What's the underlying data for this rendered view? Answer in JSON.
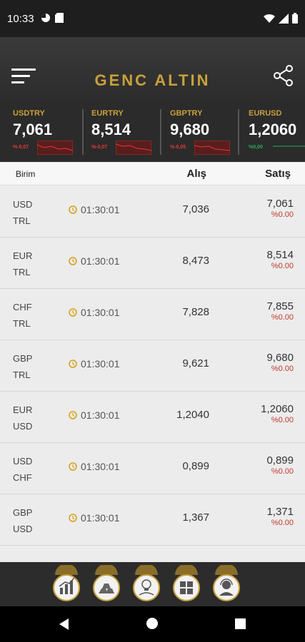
{
  "status_bar": {
    "time": "10:33",
    "left_icons": [
      "pie-icon",
      "sd-card-icon"
    ],
    "right_icons": [
      "wifi-icon",
      "signal-icon",
      "battery-icon"
    ]
  },
  "header": {
    "logo_text": "GENC ALTIN",
    "menu_icon": "menu-icon",
    "share_icon": "share-icon"
  },
  "tickers": [
    {
      "name": "USDTRY",
      "value": "7,061",
      "change": "%-0,07",
      "trend": "down"
    },
    {
      "name": "EURTRY",
      "value": "8,514",
      "change": "%-0,07",
      "trend": "down"
    },
    {
      "name": "GBPTRY",
      "value": "9,680",
      "change": "%-0,05",
      "trend": "down"
    },
    {
      "name": "EURUSD",
      "value": "1,2060",
      "change": "%0,00",
      "trend": "flat"
    }
  ],
  "colors": {
    "accent_gold": "#c9a13b",
    "down_red": "#c0392b",
    "up_green": "#27ae60"
  },
  "table": {
    "col_unit": "Birim",
    "col_buy": "Alış",
    "col_sell": "Satış",
    "rows": [
      {
        "base": "USD",
        "quote": "TRL",
        "time": "01:30:01",
        "buy": "7,036",
        "sell": "7,061",
        "change": "%0.00"
      },
      {
        "base": "EUR",
        "quote": "TRL",
        "time": "01:30:01",
        "buy": "8,473",
        "sell": "8,514",
        "change": "%0.00"
      },
      {
        "base": "CHF",
        "quote": "TRL",
        "time": "01:30:01",
        "buy": "7,828",
        "sell": "7,855",
        "change": "%0.00"
      },
      {
        "base": "GBP",
        "quote": "TRL",
        "time": "01:30:01",
        "buy": "9,621",
        "sell": "9,680",
        "change": "%0.00"
      },
      {
        "base": "EUR",
        "quote": "USD",
        "time": "01:30:01",
        "buy": "1,2040",
        "sell": "1,2060",
        "change": "%0.00"
      },
      {
        "base": "USD",
        "quote": "CHF",
        "time": "01:30:01",
        "buy": "0,899",
        "sell": "0,899",
        "change": "%0.00"
      },
      {
        "base": "GBP",
        "quote": "USD",
        "time": "01:30:01",
        "buy": "1,367",
        "sell": "1,371",
        "change": "%0.00"
      }
    ]
  },
  "bottom_nav": [
    {
      "icon": "chart-icon"
    },
    {
      "icon": "gold-bars-icon"
    },
    {
      "icon": "idea-icon"
    },
    {
      "icon": "calculator-icon"
    },
    {
      "icon": "support-icon"
    }
  ],
  "android_nav": {
    "back_icon": "back-icon",
    "home_icon": "home-icon",
    "recent_icon": "recent-apps-icon"
  }
}
